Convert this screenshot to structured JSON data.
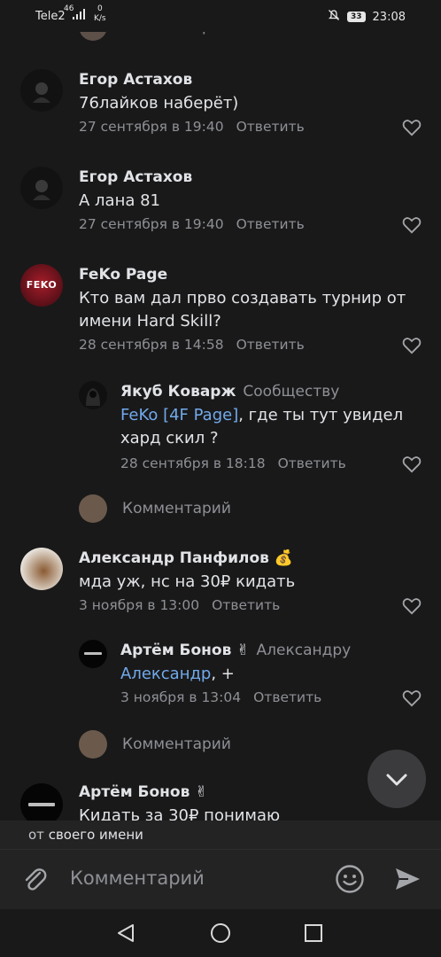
{
  "status_bar": {
    "carrier": "Tele2",
    "signal_label": "46",
    "speed_value": "0",
    "speed_unit": "K/s",
    "battery": "33",
    "time": "23:08"
  },
  "comments": [
    {
      "author": "Егор Астахов",
      "text": "76лайков наберёт)",
      "date": "27 сентября в 19:40",
      "reply_label": "Ответить"
    },
    {
      "author": "Егор Астахов",
      "text": "А лана 81",
      "date": "27 сентября в 19:40",
      "reply_label": "Ответить"
    },
    {
      "author": "FeKo Page",
      "avatar_text": "FEKO",
      "text": "Кто вам дал прво создавать турнир от имени Hard Skill?",
      "date": "28 сентября в 14:58",
      "reply_label": "Ответить"
    },
    {
      "author": "Якуб Коварж",
      "reply_to": "Сообществу",
      "mention": "FeKo [4F Page]",
      "text": ", где ты тут увидел хард скил ?",
      "date": "28 сентября в 18:18",
      "reply_label": "Ответить"
    },
    {
      "author": "Александр Панфилов 💰",
      "text": "мда уж, нс на 30₽ кидать",
      "date": "3 ноября в 13:00",
      "reply_label": "Ответить"
    },
    {
      "author": "Артём Бонов ✌",
      "reply_to": "Александру",
      "mention": "Александр",
      "text": ", +",
      "date": "3 ноября в 13:04",
      "reply_label": "Ответить"
    },
    {
      "author": "Артём Бонов ✌",
      "text": "Кидать за 30₽ понимаю"
    }
  ],
  "comment_prompt": "Комментарий",
  "mention_bar": {
    "prefix": "от",
    "value": "своего имени"
  },
  "composer": {
    "placeholder": "Комментарий"
  },
  "icons": {
    "attach": "paperclip-icon",
    "emoji": "smile-icon",
    "send": "send-icon",
    "like": "heart-icon",
    "scroll_down": "chevron-down-icon"
  }
}
